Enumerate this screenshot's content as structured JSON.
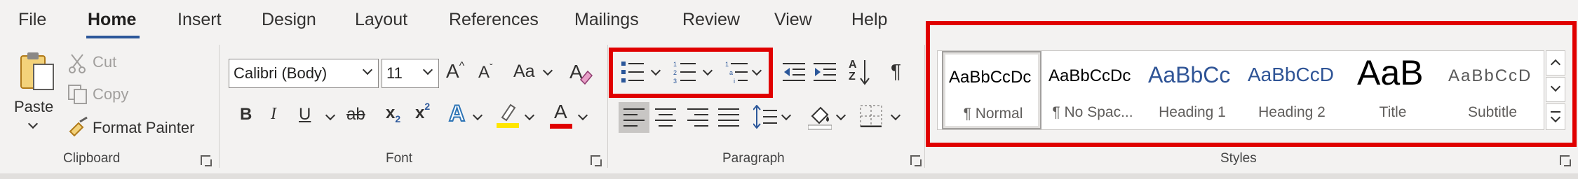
{
  "tabs": [
    "File",
    "Home",
    "Insert",
    "Design",
    "Layout",
    "References",
    "Mailings",
    "Review",
    "View",
    "Help"
  ],
  "clipboard": {
    "paste": "Paste",
    "cut": "Cut",
    "copy": "Copy",
    "format_painter": "Format Painter",
    "group_label": "Clipboard"
  },
  "font": {
    "font_name": "Calibri (Body)",
    "font_size": "11",
    "change_case": "Aa",
    "group_label": "Font",
    "bold": "B",
    "italic": "I",
    "underline": "U",
    "strikethrough": "ab",
    "subscript": "x",
    "subscript_mark": "2",
    "superscript": "x",
    "superscript_mark": "2",
    "text_effects": "A",
    "font_color": "A",
    "grow": "A",
    "shrink": "A",
    "colors": {
      "highlight": "#ffe600",
      "font_color": "#e00000",
      "text_effects": "#2e75b6"
    }
  },
  "paragraph": {
    "group_label": "Paragraph",
    "sort": "AZ",
    "pilcrow": "¶"
  },
  "styles": {
    "group_label": "Styles",
    "items": [
      {
        "sample": "AaBbCcDc",
        "name": "¶ Normal"
      },
      {
        "sample": "AaBbCcDc",
        "name": "¶ No Spac..."
      },
      {
        "sample": "AaBbCc",
        "name": "Heading 1"
      },
      {
        "sample": "AaBbCcD",
        "name": "Heading 2"
      },
      {
        "sample": "AaB",
        "name": "Title"
      },
      {
        "sample": "AaBbCcD",
        "name": "Subtitle"
      }
    ]
  },
  "highlight_color": "#e00000",
  "accent_color": "#2b579a"
}
